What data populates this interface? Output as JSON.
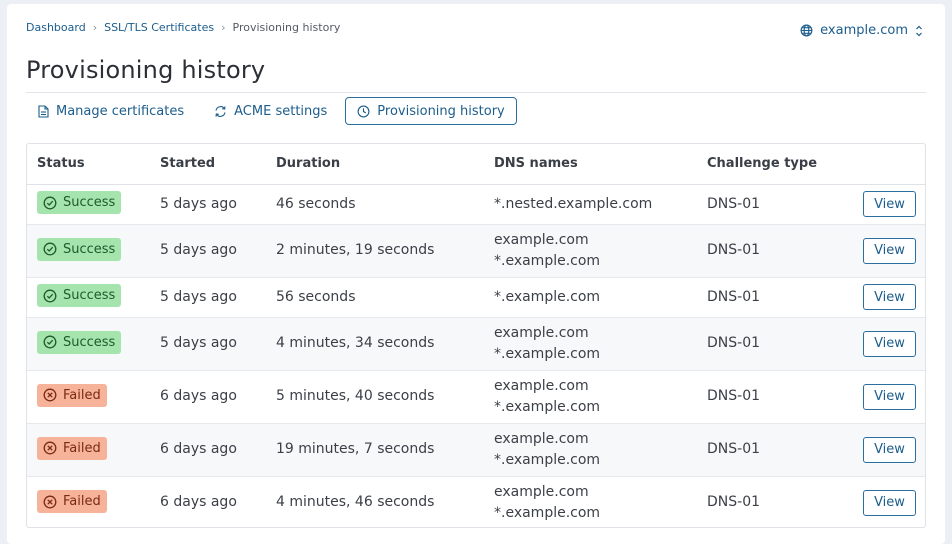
{
  "breadcrumb": [
    "Dashboard",
    "SSL/TLS Certificates",
    "Provisioning history"
  ],
  "domain_selector": {
    "value": "example.com"
  },
  "page_title": "Provisioning history",
  "tabs": [
    {
      "label": "Manage certificates",
      "icon": "document-icon",
      "active": false
    },
    {
      "label": "ACME settings",
      "icon": "refresh-icon",
      "active": false
    },
    {
      "label": "Provisioning history",
      "icon": "clock-icon",
      "active": true
    }
  ],
  "table": {
    "columns": [
      "Status",
      "Started",
      "Duration",
      "DNS names",
      "Challenge type",
      ""
    ],
    "rows": [
      {
        "status": "Success",
        "started": "5 days ago",
        "duration": "46 seconds",
        "dns": [
          "*.nested.example.com"
        ],
        "challenge": "DNS-01",
        "action": "View"
      },
      {
        "status": "Success",
        "started": "5 days ago",
        "duration": "2 minutes, 19 seconds",
        "dns": [
          "example.com",
          "*.example.com"
        ],
        "challenge": "DNS-01",
        "action": "View"
      },
      {
        "status": "Success",
        "started": "5 days ago",
        "duration": "56 seconds",
        "dns": [
          "*.example.com"
        ],
        "challenge": "DNS-01",
        "action": "View"
      },
      {
        "status": "Success",
        "started": "5 days ago",
        "duration": "4 minutes, 34 seconds",
        "dns": [
          "example.com",
          "*.example.com"
        ],
        "challenge": "DNS-01",
        "action": "View"
      },
      {
        "status": "Failed",
        "started": "6 days ago",
        "duration": "5 minutes, 40 seconds",
        "dns": [
          "example.com",
          "*.example.com"
        ],
        "challenge": "DNS-01",
        "action": "View"
      },
      {
        "status": "Failed",
        "started": "6 days ago",
        "duration": "19 minutes, 7 seconds",
        "dns": [
          "example.com",
          "*.example.com"
        ],
        "challenge": "DNS-01",
        "action": "View"
      },
      {
        "status": "Failed",
        "started": "6 days ago",
        "duration": "4 minutes, 46 seconds",
        "dns": [
          "example.com",
          "*.example.com"
        ],
        "challenge": "DNS-01",
        "action": "View"
      }
    ]
  },
  "colors": {
    "link": "#1c5d8c",
    "success_bg": "#a6e4ae",
    "failed_bg": "#f6b39a",
    "page_bg": "#eceff3"
  }
}
